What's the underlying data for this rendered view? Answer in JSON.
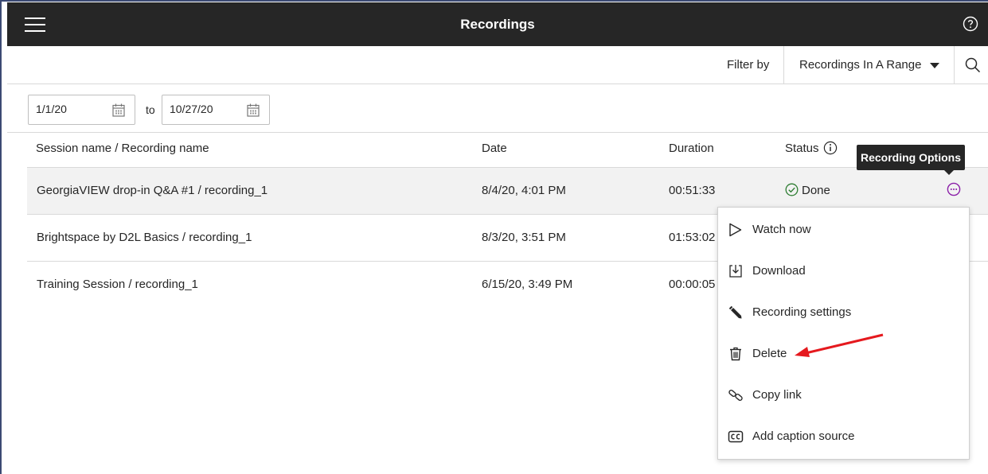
{
  "header": {
    "title": "Recordings"
  },
  "filter": {
    "label": "Filter by",
    "selected": "Recordings In A Range"
  },
  "date_range": {
    "from": "1/1/20",
    "to_label": "to",
    "to": "10/27/20"
  },
  "table": {
    "columns": [
      "Session name / Recording name",
      "Date",
      "Duration",
      "Status"
    ],
    "rows": [
      {
        "name": "GeorgiaVIEW drop-in Q&A #1 / recording_1",
        "date": "8/4/20, 4:01 PM",
        "duration": "00:51:33",
        "status": "Done"
      },
      {
        "name": "Brightspace by D2L Basics / recording_1",
        "date": "8/3/20, 3:51 PM",
        "duration": "01:53:02",
        "status": ""
      },
      {
        "name": "Training Session / recording_1",
        "date": "6/15/20, 3:49 PM",
        "duration": "00:00:05",
        "status": ""
      }
    ]
  },
  "tooltip": "Recording Options",
  "options_menu": [
    {
      "label": "Watch now",
      "icon": "play-icon"
    },
    {
      "label": "Download",
      "icon": "download-icon"
    },
    {
      "label": "Recording settings",
      "icon": "pencil-icon"
    },
    {
      "label": "Delete",
      "icon": "trash-icon"
    },
    {
      "label": "Copy link",
      "icon": "link-icon"
    },
    {
      "label": "Add caption source",
      "icon": "cc-icon"
    }
  ],
  "colors": {
    "topbar": "#262626",
    "accent": "#8b1fa8",
    "done": "#2e7d32",
    "annotation": "#e5191e"
  }
}
